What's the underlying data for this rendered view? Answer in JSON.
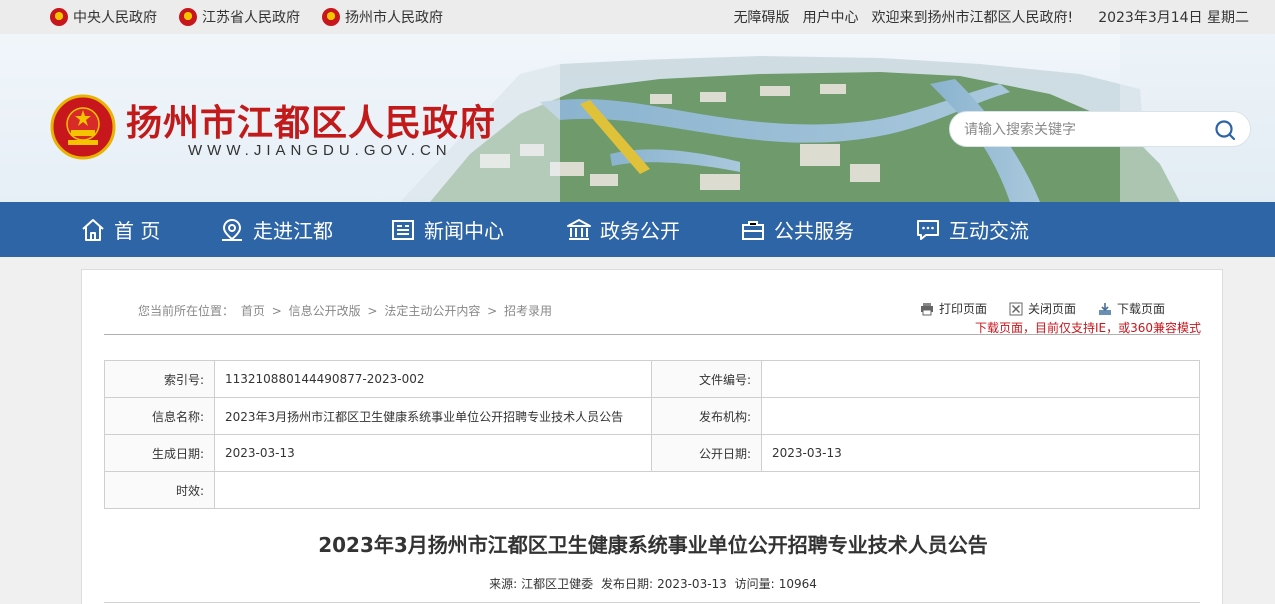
{
  "topbar": {
    "links": [
      "中央人民政府",
      "江苏省人民政府",
      "扬州市人民政府"
    ],
    "accessibility": "无障碍版",
    "user_center": "用户中心",
    "welcome": "欢迎来到扬州市江都区人民政府!",
    "date": "2023年3月14日 星期二"
  },
  "header": {
    "title": "扬州市江都区人民政府",
    "url": "WWW.JIANGDU.GOV.CN",
    "search_placeholder": "请输入搜索关键字"
  },
  "nav": {
    "items": [
      {
        "label": "首 页",
        "icon": "home-icon"
      },
      {
        "label": "走进江都",
        "icon": "map-pin-icon"
      },
      {
        "label": "新闻中心",
        "icon": "news-icon"
      },
      {
        "label": "政务公开",
        "icon": "government-icon"
      },
      {
        "label": "公共服务",
        "icon": "briefcase-icon"
      },
      {
        "label": "互动交流",
        "icon": "chat-icon"
      }
    ]
  },
  "breadcrumb": {
    "prefix": "您当前所在位置：",
    "items": [
      "首页",
      "信息公开改版",
      "法定主动公开内容",
      "招考录用"
    ],
    "separator": ">"
  },
  "tools": {
    "print": "打印页面",
    "close": "关闭页面",
    "download": "下载页面",
    "note": "下载页面，目前仅支持IE，或360兼容模式"
  },
  "meta": {
    "index_label": "索引号:",
    "index_value": "113210880144490877-2023-002",
    "docno_label": "文件编号:",
    "docno_value": "",
    "name_label": "信息名称:",
    "name_value": "2023年3月扬州市江都区卫生健康系统事业单位公开招聘专业技术人员公告",
    "org_label": "发布机构:",
    "org_value": "",
    "created_label": "生成日期:",
    "created_value": "2023-03-13",
    "public_label": "公开日期:",
    "public_value": "2023-03-13",
    "valid_label": "时效:",
    "valid_value": ""
  },
  "article": {
    "title": "2023年3月扬州市江都区卫生健康系统事业单位公开招聘专业技术人员公告",
    "source_label": "来源:",
    "source": "江都区卫健委",
    "date_label": "发布日期:",
    "date": "2023-03-13",
    "views_label": "访问量:",
    "views": "10964"
  },
  "colors": {
    "nav_bg": "#2e65a6",
    "title_red": "#c21a1a",
    "note_red": "#c8161d"
  }
}
